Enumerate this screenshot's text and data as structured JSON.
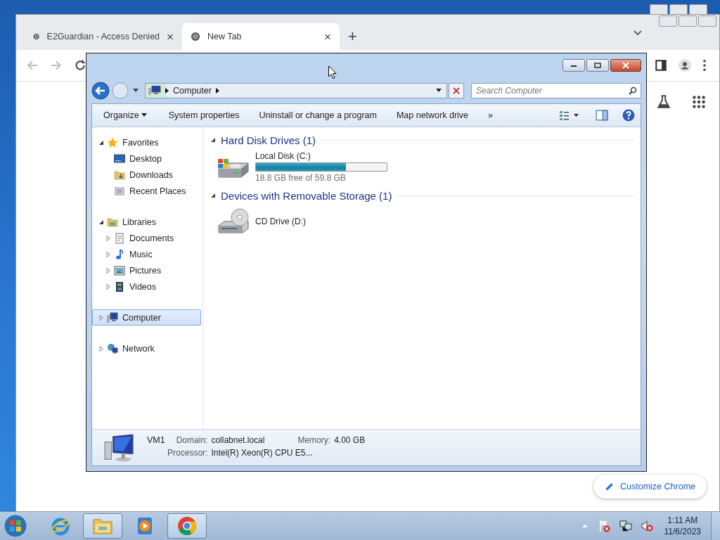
{
  "browser": {
    "tabs": [
      {
        "title": "E2Guardian - Access Denied",
        "selected": false,
        "close": "×"
      },
      {
        "title": "New Tab",
        "selected": true,
        "close": "×"
      }
    ],
    "new_tab": "+",
    "customize_button": "Customize Chrome"
  },
  "explorer": {
    "address": [
      "Computer"
    ],
    "search": {
      "placeholder": "Search Computer"
    },
    "toolbar": [
      "Organize",
      "System properties",
      "Uninstall or change a program",
      "Map network drive"
    ],
    "overflow": "»",
    "nav": [
      {
        "label": "Favorites",
        "kind": "star",
        "expanded": true,
        "selected": false,
        "children": [
          {
            "label": "Desktop",
            "kind": "desktop",
            "selected": false
          },
          {
            "label": "Downloads",
            "kind": "downloads",
            "selected": false
          },
          {
            "label": "Recent Places",
            "kind": "recent",
            "selected": false
          }
        ]
      },
      {
        "label": "Libraries",
        "kind": "libraries",
        "expanded": true,
        "selected": false,
        "children": [
          {
            "label": "Documents",
            "kind": "documents",
            "expanded": false,
            "selected": false
          },
          {
            "label": "Music",
            "kind": "music",
            "expanded": false,
            "selected": false
          },
          {
            "label": "Pictures",
            "kind": "pictures",
            "expanded": false,
            "selected": false
          },
          {
            "label": "Videos",
            "kind": "videos",
            "expanded": false,
            "selected": false
          }
        ]
      },
      {
        "label": "Computer",
        "kind": "computer",
        "expanded": false,
        "selected": true
      },
      {
        "label": "Network",
        "kind": "network",
        "expanded": false,
        "selected": false
      }
    ],
    "groups": [
      {
        "title": "Hard Disk Drives (1)",
        "expanded": true,
        "items": [
          {
            "kind": "disk",
            "name": "Local Disk (C:)",
            "level": 0.686,
            "reading": "18.8 GB free of 59.8 GB"
          }
        ]
      },
      {
        "title": "Devices with Removable Storage (1)",
        "expanded": true,
        "items": [
          {
            "kind": "cd",
            "name": "CD Drive (D:)"
          }
        ]
      }
    ],
    "details": {
      "name": "VM1",
      "fields": [
        {
          "label": "Domain:",
          "value": "collabnet.local"
        },
        {
          "label": "Memory:",
          "value": "4.00 GB"
        },
        {
          "label": "Processor:",
          "value": "Intel(R) Xeon(R) CPU E5..."
        }
      ]
    }
  },
  "taskbar": {
    "items": [
      {
        "kind": "explorer",
        "selected": true
      },
      {
        "kind": "media",
        "selected": false
      },
      {
        "kind": "chrome",
        "selected": true
      }
    ],
    "clock": {
      "time": "1:11 AM",
      "date": "11/6/2023"
    }
  }
}
